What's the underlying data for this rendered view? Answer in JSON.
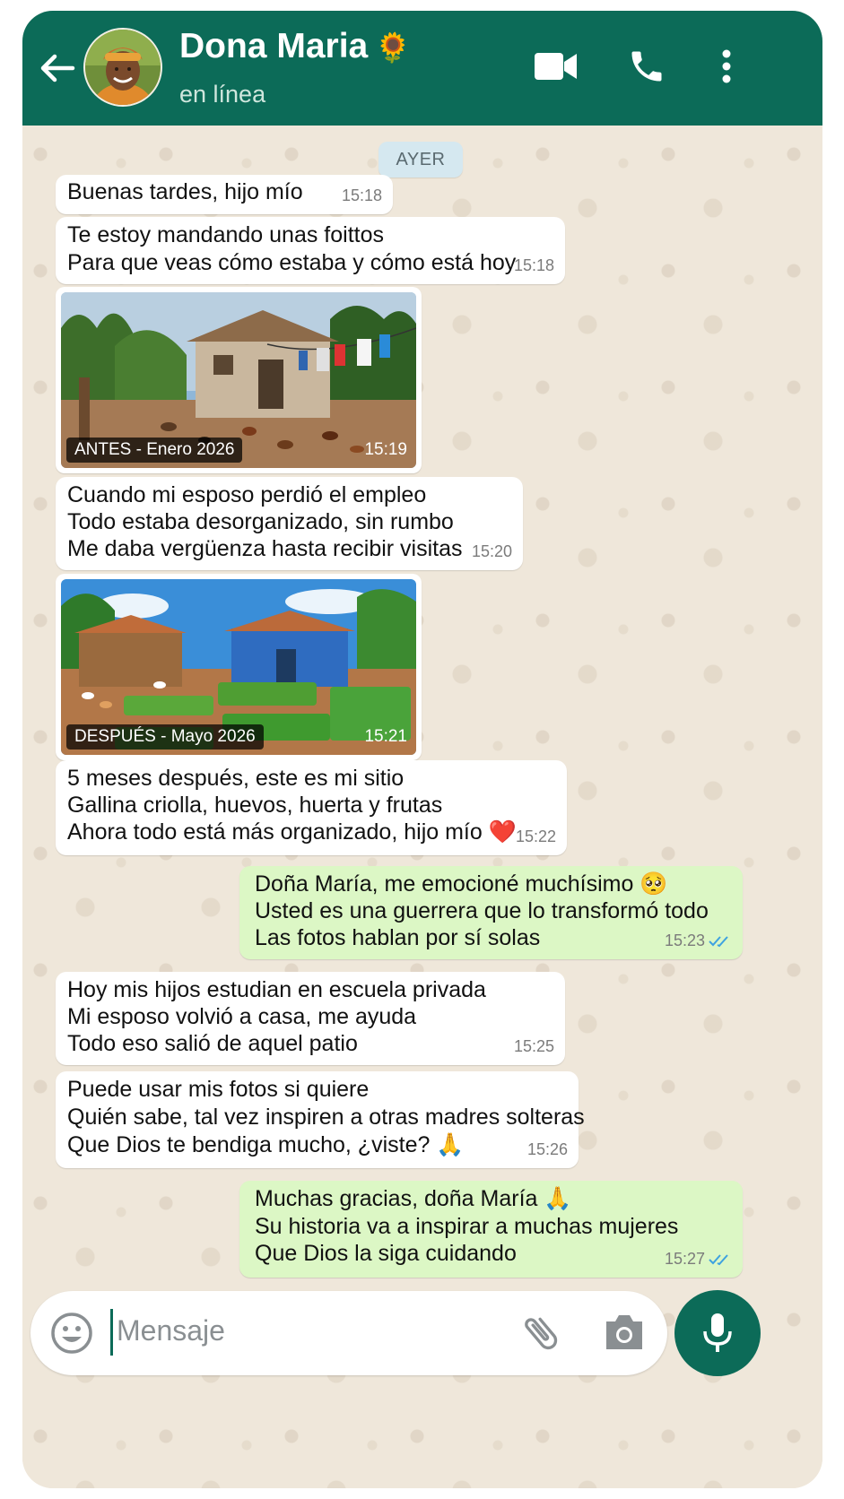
{
  "header": {
    "contact_name": "Dona Maria",
    "name_emoji": "🌻",
    "status": "en línea",
    "icons": [
      "back-arrow-icon",
      "video-call-icon",
      "phone-icon",
      "more-vert-icon"
    ],
    "color": "#0c6b58"
  },
  "date_badge": "AYER",
  "messages": [
    {
      "dir": "in",
      "lines": [
        "Buenas tardes, hijo mío"
      ],
      "time": "15:18"
    },
    {
      "dir": "in",
      "lines": [
        "Te estoy mandando unas foittos",
        "Para que veas cómo estaba y cómo está hoy"
      ],
      "time": "15:18"
    },
    {
      "dir": "in",
      "type": "image",
      "caption": "ANTES - Enero 2026",
      "time": "15:19"
    },
    {
      "dir": "in",
      "lines": [
        "Cuando mi esposo perdió el empleo",
        "Todo estaba desorganizado, sin rumbo",
        "Me daba vergüenza hasta recibir visitas"
      ],
      "time": "15:20"
    },
    {
      "dir": "in",
      "type": "image",
      "caption": "DESPUÉS - Mayo 2026",
      "time": "15:21"
    },
    {
      "dir": "in",
      "lines": [
        "5 meses después, este es mi sitio",
        "Gallina criolla, huevos, huerta y frutas",
        "Ahora todo está más organizado, hijo mío ❤️"
      ],
      "time": "15:22"
    },
    {
      "dir": "out",
      "lines": [
        "Doña María, me emocioné muchísimo 🥺",
        "Usted es una guerrera que lo transformó todo",
        "Las fotos hablan por sí solas"
      ],
      "time": "15:23",
      "read": true
    },
    {
      "dir": "in",
      "lines": [
        "Hoy mis hijos estudian en escuela privada",
        "Mi esposo volvió a casa, me ayuda",
        "Todo eso salió de aquel patio"
      ],
      "time": "15:25"
    },
    {
      "dir": "in",
      "lines": [
        "Puede usar mis fotos si quiere",
        "Quién sabe, tal vez inspiren a otras madres solteras",
        "Que Dios te bendiga mucho, ¿viste? 🙏"
      ],
      "time": "15:26"
    },
    {
      "dir": "out",
      "lines": [
        "Muchas gracias, doña María 🙏",
        "Su historia va a inspirar a muchas mujeres",
        "Que Dios la siga cuidando"
      ],
      "time": "15:27",
      "read": true
    }
  ],
  "input": {
    "placeholder": "Mensaje",
    "icons": [
      "emoji-icon",
      "attach-icon",
      "camera-icon",
      "mic-icon"
    ]
  }
}
